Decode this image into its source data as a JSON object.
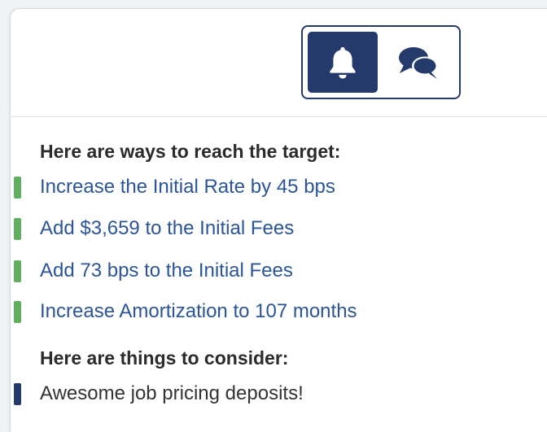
{
  "toggle": {
    "buttons": [
      {
        "icon": "bell-icon",
        "active": true
      },
      {
        "icon": "chat-bubbles-icon",
        "active": false
      }
    ]
  },
  "sections": {
    "target": {
      "heading": "Here are ways to reach the target:",
      "items": [
        "Increase the Initial Rate by 45 bps",
        "Add $3,659 to the Initial Fees",
        "Add 73 bps to the Initial Fees",
        "Increase Amortization to 107 months"
      ]
    },
    "consider": {
      "heading": "Here are things to consider:",
      "items": [
        "Awesome job pricing deposits!"
      ]
    }
  },
  "colors": {
    "primary": "#233a6b",
    "success_marker": "#5faf5f",
    "link": "#2b5597"
  }
}
